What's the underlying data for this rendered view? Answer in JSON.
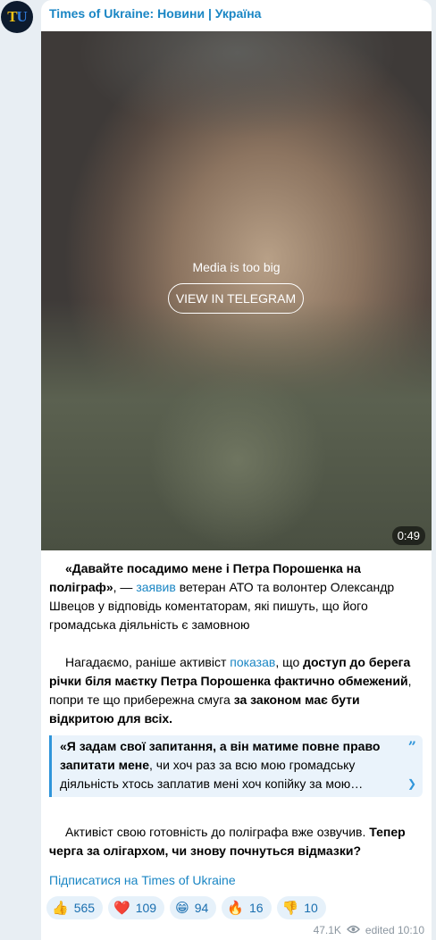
{
  "channel": {
    "title": "Times of Ukraine: Новини | Україна",
    "avatar_t": "T",
    "avatar_u": "U"
  },
  "media": {
    "note": "Media is too big",
    "button": "VIEW IN TELEGRAM",
    "duration": "0:49"
  },
  "post": {
    "p1_bold": "«Давайте посадимо мене і Петра Порошенка на поліграф»",
    "p1_dash": ", — ",
    "p1_link": "заявив",
    "p1_rest": " ветеран АТО та волонтер Олександр Швецов у відповідь коментаторам, які пишуть, що його громадська діяльність є замовною",
    "p2_a": "Нагадаємо, раніше активіст ",
    "p2_link": "показав",
    "p2_b": ", що ",
    "p2_bold1": "доступ до берега річки біля маєтку Петра Порошенка фактично обмежений",
    "p2_c": ", попри те що прибережна смуга ",
    "p2_bold2": "за законом має бути відкритою для всіх.",
    "quote_bold": "«Я задам свої запитання, а він матиме повне право запитати мене",
    "quote_rest": ", чи хоч раз за всю мою громадську діяльність хтось заплатив мені хоч копійку за мою…",
    "p3_a": "Активіст свою готовність до поліграфа вже озвучив. ",
    "p3_bold": "Тепер черга за олігархом, чи знову почнуться відмазки?",
    "subscribe": "Підписатися на Times of Ukraine"
  },
  "reactions": [
    {
      "emoji": "👍",
      "count": "565",
      "icon": "thumbs-up-icon"
    },
    {
      "emoji": "❤️",
      "count": "109",
      "icon": "heart-icon"
    },
    {
      "emoji": "😁",
      "count": "94",
      "icon": "grin-icon"
    },
    {
      "emoji": "🔥",
      "count": "16",
      "icon": "fire-icon"
    },
    {
      "emoji": "👎",
      "count": "10",
      "icon": "thumbs-down-icon"
    }
  ],
  "meta": {
    "views": "47.1K",
    "edited": "edited",
    "time": "10:10"
  },
  "colors": {
    "link": "#1a86c4",
    "quote_accent": "#2f95da",
    "background": "#e8eef3"
  }
}
